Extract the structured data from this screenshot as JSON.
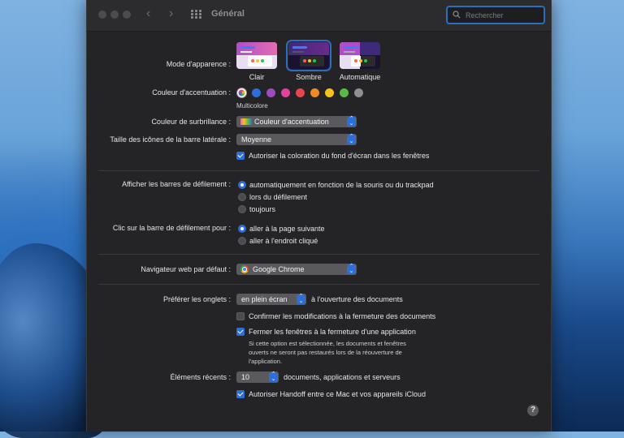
{
  "window": {
    "title": "Général"
  },
  "search": {
    "placeholder": "Rechercher"
  },
  "appearance": {
    "label": "Mode d'apparence :",
    "options": [
      "Clair",
      "Sombre",
      "Automatique"
    ],
    "selected": "Sombre"
  },
  "accent": {
    "label": "Couleur d'accentuation :",
    "colors": [
      "multicolor",
      "#2d6fd6",
      "#9b4dbf",
      "#e0449a",
      "#e8464c",
      "#f08a24",
      "#f5c21b",
      "#5ab946",
      "#8e8e93"
    ],
    "selected_name": "Multicolore"
  },
  "highlight": {
    "label": "Couleur de surbrillance :",
    "value": "Couleur d'accentuation"
  },
  "sidebar_icons": {
    "label": "Taille des icônes de la barre latérale :",
    "value": "Moyenne"
  },
  "wallpaper_tint": {
    "label": "Autoriser la coloration du fond d'écran dans les fenêtres",
    "checked": true
  },
  "scrollbars": {
    "label": "Afficher les barres de défilement :",
    "options": [
      "automatiquement en fonction de la souris ou du trackpad",
      "lors du défilement",
      "toujours"
    ],
    "selected": "automatiquement en fonction de la souris ou du trackpad"
  },
  "scroll_click": {
    "label": "Clic sur la barre de défilement pour :",
    "options": [
      "aller à la page suivante",
      "aller à l'endroit cliqué"
    ],
    "selected": "aller à la page suivante"
  },
  "browser": {
    "label": "Navigateur web par défaut :",
    "value": "Google Chrome"
  },
  "tabs": {
    "label": "Préférer les onglets :",
    "value": "en plein écran",
    "suffix": "à l'ouverture des documents"
  },
  "confirm_changes": {
    "label": "Confirmer les modifications à la fermeture des documents",
    "checked": false
  },
  "close_windows": {
    "label": "Fermer les fenêtres à la fermeture d'une application",
    "checked": true,
    "note_lines": [
      "Si cette option est sélectionnée, les documents et fenêtres",
      "ouverts ne seront pas restaurés lors de la réouverture de",
      "l'application."
    ]
  },
  "recent": {
    "label": "Éléments récents :",
    "value": "10",
    "suffix": "documents, applications et serveurs"
  },
  "handoff": {
    "label": "Autoriser Handoff entre ce Mac et vos appareils iCloud",
    "checked": true
  },
  "help": {
    "label": "?"
  }
}
